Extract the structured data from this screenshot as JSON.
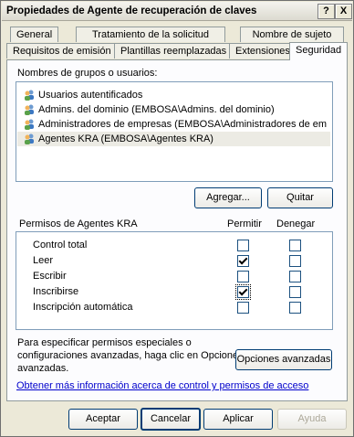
{
  "window": {
    "title": "Propiedades de Agente de recuperación de claves",
    "help_btn": "?",
    "close_btn": "X"
  },
  "tabs_back": [
    "General",
    "Tratamiento de la solicitud",
    "Nombre de sujeto"
  ],
  "tabs_front": [
    "Requisitos de emisión",
    "Plantillas reemplazadas",
    "Extensiones",
    "Seguridad"
  ],
  "groups": {
    "label": "Nombres de grupos o usuarios:",
    "items": [
      "Usuarios autentificados",
      "Admins. del dominio (EMBOSA\\Admins. del dominio)",
      "Administradores de empresas (EMBOSA\\Administradores de empres...",
      "Agentes KRA (EMBOSA\\Agentes KRA)"
    ],
    "selected_index": 3
  },
  "buttons": {
    "add": "Agregar...",
    "remove": "Quitar",
    "advanced": "Opciones avanzadas",
    "ok": "Aceptar",
    "cancel": "Cancelar",
    "apply": "Aplicar",
    "help": "Ayuda"
  },
  "permissions": {
    "header": "Permisos de Agentes KRA",
    "allow_col": "Permitir",
    "deny_col": "Denegar",
    "rows": [
      {
        "name": "Control total",
        "allow": false,
        "deny": false
      },
      {
        "name": "Leer",
        "allow": true,
        "deny": false
      },
      {
        "name": "Escribir",
        "allow": false,
        "deny": false
      },
      {
        "name": "Inscribirse",
        "allow": true,
        "deny": false
      },
      {
        "name": "Inscripción automática",
        "allow": false,
        "deny": false
      }
    ]
  },
  "special": {
    "line1": "Para especificar permisos especiales o",
    "line2": "configuraciones avanzadas, haga clic en Opciones",
    "line3": "avanzadas."
  },
  "link": "Obtener más información acerca de control y permisos de acceso",
  "icons": [
    "users-group-icon"
  ]
}
